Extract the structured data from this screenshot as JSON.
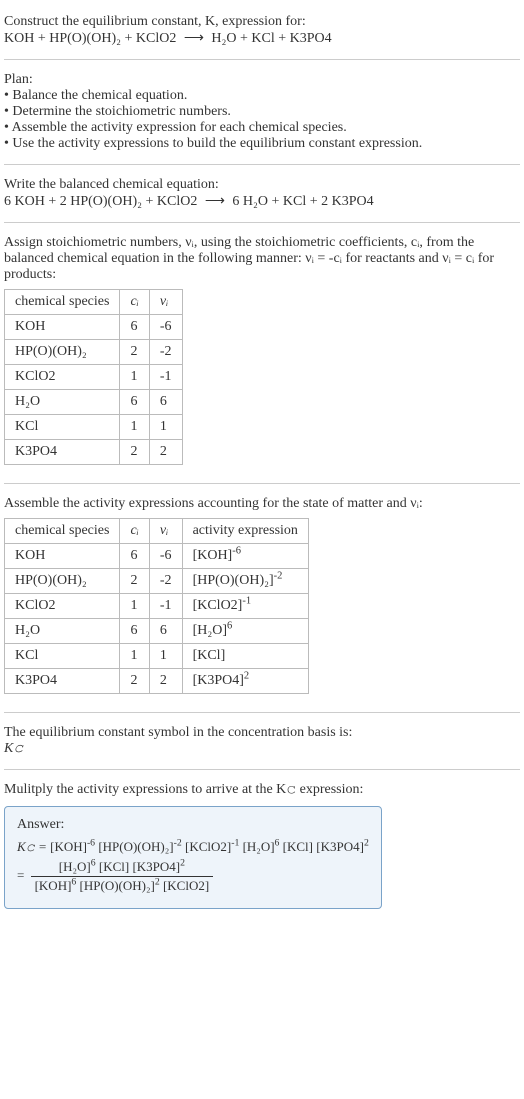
{
  "title_line1": "Construct the equilibrium constant, K, expression for:",
  "unbalanced_lhs": "KOH + HP(O)(OH)₂ + KClO2",
  "arrow": "⟶",
  "unbalanced_rhs": "H₂O + KCl + K3PO4",
  "plan_heading": "Plan:",
  "plan_items": [
    "• Balance the chemical equation.",
    "• Determine the stoichiometric numbers.",
    "• Assemble the activity expression for each chemical species.",
    "• Use the activity expressions to build the equilibrium constant expression."
  ],
  "write_balanced": "Write the balanced chemical equation:",
  "balanced_lhs": "6 KOH + 2 HP(O)(OH)₂ + KClO2",
  "balanced_rhs": "6 H₂O + KCl + 2 K3PO4",
  "assign_text": "Assign stoichiometric numbers, νᵢ, using the stoichiometric coefficients, cᵢ, from the balanced chemical equation in the following manner: νᵢ = -cᵢ for reactants and νᵢ = cᵢ for products:",
  "table1_headers": [
    "chemical species",
    "cᵢ",
    "νᵢ"
  ],
  "table1_rows": [
    [
      "KOH",
      "6",
      "-6"
    ],
    [
      "HP(O)(OH)₂",
      "2",
      "-2"
    ],
    [
      "KClO2",
      "1",
      "-1"
    ],
    [
      "H₂O",
      "6",
      "6"
    ],
    [
      "KCl",
      "1",
      "1"
    ],
    [
      "K3PO4",
      "2",
      "2"
    ]
  ],
  "assemble_text": "Assemble the activity expressions accounting for the state of matter and νᵢ:",
  "table2_headers": [
    "chemical species",
    "cᵢ",
    "νᵢ",
    "activity expression"
  ],
  "table2_rows": [
    {
      "sp": "KOH",
      "c": "6",
      "v": "-6",
      "base": "[KOH]",
      "exp": "-6"
    },
    {
      "sp": "HP(O)(OH)₂",
      "c": "2",
      "v": "-2",
      "base": "[HP(O)(OH)₂]",
      "exp": "-2"
    },
    {
      "sp": "KClO2",
      "c": "1",
      "v": "-1",
      "base": "[KClO2]",
      "exp": "-1"
    },
    {
      "sp": "H₂O",
      "c": "6",
      "v": "6",
      "base": "[H₂O]",
      "exp": "6"
    },
    {
      "sp": "KCl",
      "c": "1",
      "v": "1",
      "base": "[KCl]",
      "exp": ""
    },
    {
      "sp": "K3PO4",
      "c": "2",
      "v": "2",
      "base": "[K3PO4]",
      "exp": "2"
    }
  ],
  "kc_symbol_intro": "The equilibrium constant symbol in the concentration basis is:",
  "kc_symbol": "K𝚌",
  "multiply_text": "Mulitply the activity expressions to arrive at the K𝚌 expression:",
  "answer_label": "Answer:",
  "kc_eq_label": "K𝚌 = ",
  "kc_flat_terms": [
    {
      "base": "[KOH]",
      "exp": "-6"
    },
    {
      "base": "[HP(O)(OH)₂]",
      "exp": "-2"
    },
    {
      "base": "[KClO2]",
      "exp": "-1"
    },
    {
      "base": "[H₂O]",
      "exp": "6"
    },
    {
      "base": "[KCl]",
      "exp": ""
    },
    {
      "base": "[K3PO4]",
      "exp": "2"
    }
  ],
  "equals": " = ",
  "kc_frac_num": [
    {
      "base": "[H₂O]",
      "exp": "6"
    },
    {
      "base": "[KCl]",
      "exp": ""
    },
    {
      "base": "[K3PO4]",
      "exp": "2"
    }
  ],
  "kc_frac_den": [
    {
      "base": "[KOH]",
      "exp": "6"
    },
    {
      "base": "[HP(O)(OH)₂]",
      "exp": "2"
    },
    {
      "base": "[KClO2]",
      "exp": ""
    }
  ]
}
